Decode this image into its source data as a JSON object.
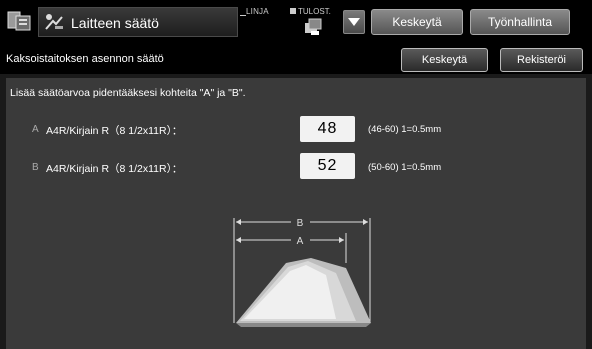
{
  "topbar": {
    "title": "Laitteen säätö",
    "linja_label": "LINJA",
    "tulost_label": "TULOST.",
    "stop_button": "Keskeytä",
    "job_status_button": "Työnhallinta"
  },
  "subheader": {
    "title": "Kaksoistaitoksen asennon säätö",
    "cancel_button": "Keskeytä",
    "register_button": "Rekisteröi"
  },
  "main": {
    "instruction": "Lisää säätöarvoa pidentääksesi kohteita \"A\" ja \"B\".",
    "rows": [
      {
        "letter": "A",
        "label": "A4R/Kirjain R（8 1/2x11R）：",
        "value": "48",
        "range": "(46-60) 1=0.5mm"
      },
      {
        "letter": "B",
        "label": "A4R/Kirjain R（8 1/2x11R）：",
        "value": "52",
        "range": "(50-60) 1=0.5mm"
      }
    ],
    "diagram": {
      "label_b": "B",
      "label_a": "A"
    }
  }
}
